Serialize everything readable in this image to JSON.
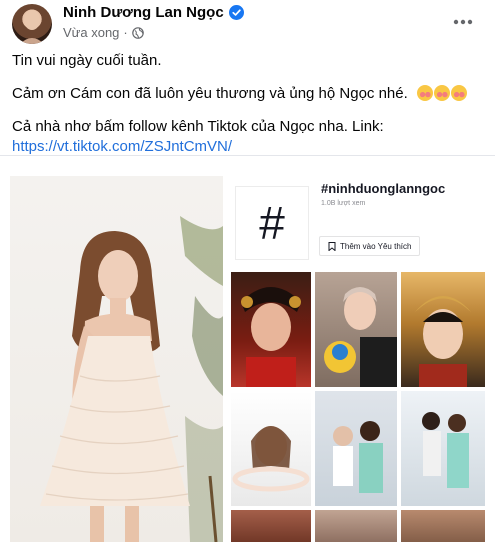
{
  "post": {
    "author": {
      "name": "Ninh Dương Lan Ngọc",
      "verified": true
    },
    "meta": {
      "time": "Vừa xong",
      "separator": "·",
      "audience_icon": "globe-icon"
    },
    "more_icon": "more-horizontal-icon",
    "text": {
      "line1": "Tin vui ngày cuối tuần.",
      "line2": "Cảm ơn Cám con đã luôn yêu thương và ủng hộ Ngọc nhé.",
      "emoji": "smiling-face-with-hearts",
      "line3": "Cả nhà nhơ bấm follow kênh Tiktok của Ngọc nha. Link:",
      "link": "https://vt.tiktok.com/ZSJntCmVN/"
    },
    "colors": {
      "link": "#216fdb",
      "verified": "#1877f2",
      "secondary_text": "#65676b"
    }
  },
  "tiktok_card": {
    "hashtag_symbol": "#",
    "title": "#ninhduonglanngoc",
    "views": "1.0B lượt xem",
    "favorite_button": "Thêm vào Yêu thích"
  }
}
